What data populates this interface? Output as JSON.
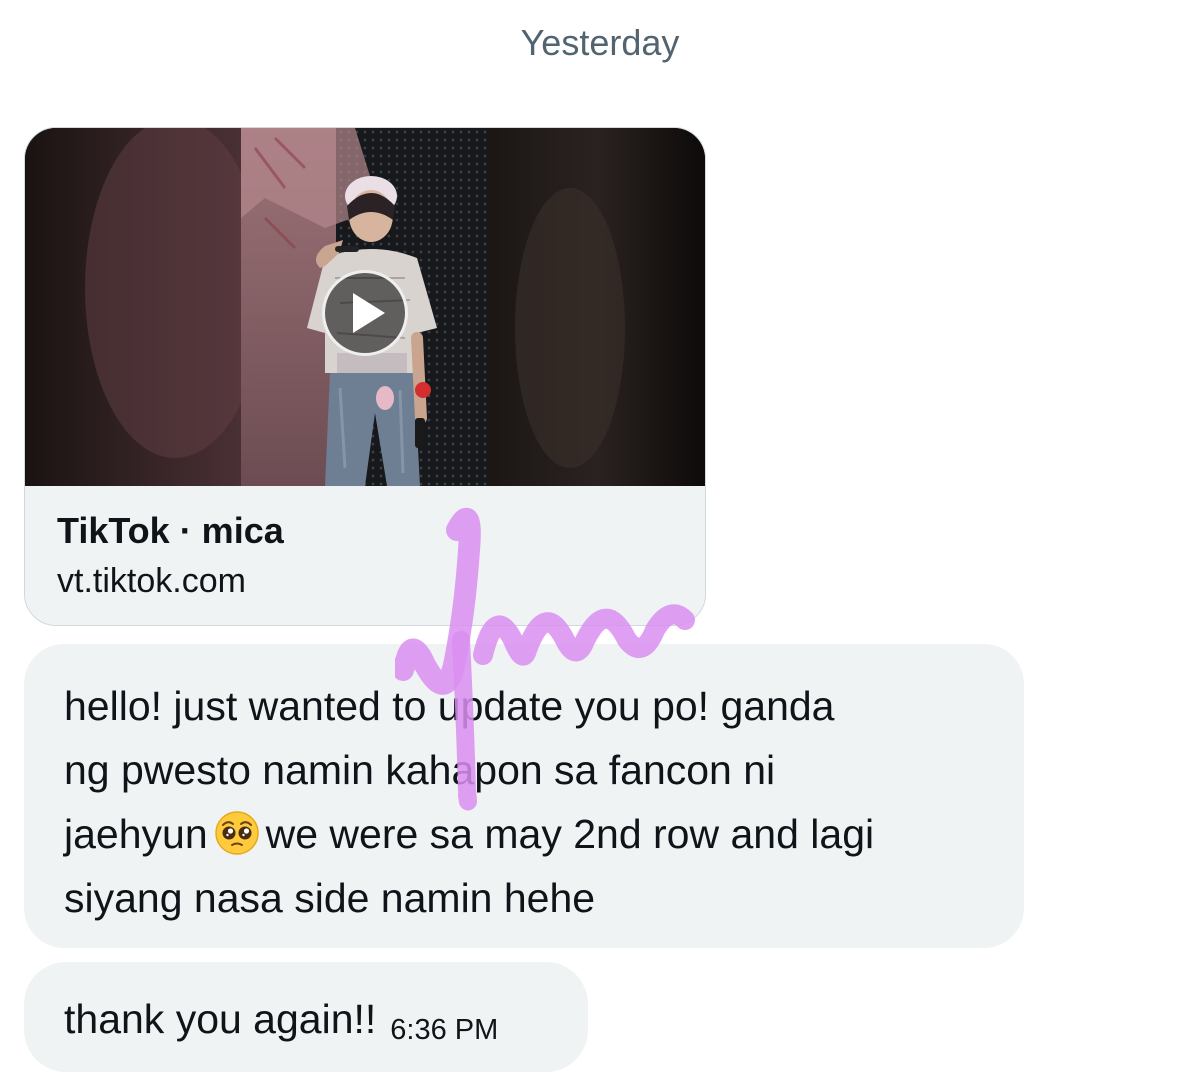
{
  "date_separator": "Yesterday",
  "link_card": {
    "title": "TikTok · mica",
    "domain": "vt.tiktok.com"
  },
  "messages": [
    {
      "lines": [
        "hello! just wanted to update you po! ganda",
        "ng pwesto namin kahapon sa fancon ni",
        "jaehyun",
        "we were sa may 2nd row and lagi",
        "siyang nasa side namin hehe"
      ],
      "emoji": "pleading-face-emoji"
    },
    {
      "text": "thank you again!!",
      "time": "6:36 PM"
    }
  ],
  "icons": {
    "play": "play-icon",
    "scribble": "handwritten-scribble"
  },
  "colors": {
    "bubble_bg": "#eff3f4",
    "secondary_text": "#536471",
    "primary_text": "#0f1419",
    "scribble": "#d98ef0"
  }
}
